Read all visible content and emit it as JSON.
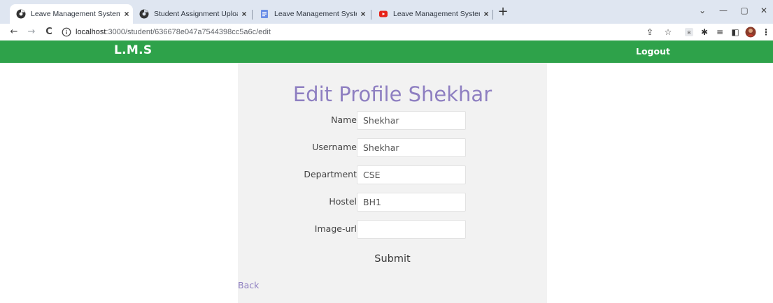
{
  "browser": {
    "tabs": [
      {
        "title": "Leave Management System",
        "favicon": "chrome-globe-icon",
        "active": true
      },
      {
        "title": "Student Assignment Upload",
        "favicon": "chrome-globe-icon",
        "active": false
      },
      {
        "title": "Leave Management System Proje",
        "favicon": "docs-icon",
        "active": false
      },
      {
        "title": "Leave Management System Proje",
        "favicon": "youtube-icon",
        "active": false
      }
    ],
    "close_glyph": "×",
    "new_tab_glyph": "+",
    "url_host": "localhost",
    "url_path": ":3000/student/636678e047a7544398cc5a6c/edit",
    "colors": {
      "tabstrip": "#dfe6f1",
      "youtube": "#e62117"
    }
  },
  "app": {
    "brand": "L.M.S",
    "logout": "Logout",
    "colors": {
      "navbar": "#2ea24a",
      "accent": "#8e7fc1",
      "card": "#f2f2f2"
    }
  },
  "form": {
    "heading": "Edit Profile Shekhar",
    "fields": [
      {
        "label": "Name",
        "value": "Shekhar"
      },
      {
        "label": "Username",
        "value": "Shekhar"
      },
      {
        "label": "Department",
        "value": "CSE"
      },
      {
        "label": "Hostel",
        "value": "BH1"
      },
      {
        "label": "Image-url",
        "value": ""
      }
    ],
    "submit": "Submit",
    "back": "Back"
  }
}
